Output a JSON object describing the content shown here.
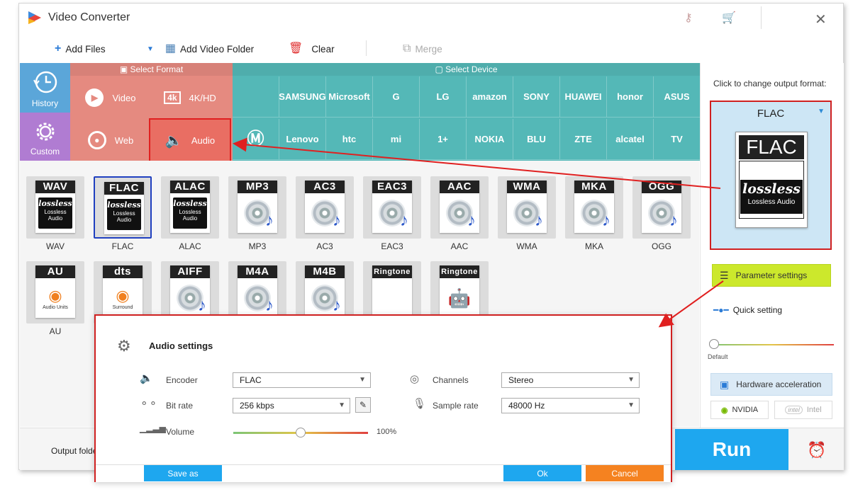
{
  "app": {
    "title": "Video Converter"
  },
  "toolbar": {
    "add_files": "Add Files",
    "add_folder": "Add Video Folder",
    "clear": "Clear",
    "merge": "Merge"
  },
  "tiles": {
    "history": "History",
    "custom": "Custom"
  },
  "format_panel": {
    "title": "Select Format",
    "video": "Video",
    "k4": "4K/HD",
    "web": "Web",
    "audio": "Audio"
  },
  "device_panel": {
    "title": "Select Device",
    "row1": [
      "",
      "SAMSUNG",
      "Microsoft",
      "G",
      "LG",
      "amazon",
      "SONY",
      "HUAWEI",
      "honor",
      "ASUS"
    ],
    "row2": [
      "",
      "Lenovo",
      "htc",
      "mi",
      "1+",
      "NOKIA",
      "BLU",
      "ZTE",
      "alcatel",
      "TV"
    ]
  },
  "formats": {
    "row1": [
      {
        "hdr": "WAV",
        "label": "WAV",
        "kind": "lossless",
        "l1": "lossless",
        "l2": "Lossless",
        "l3": "Audio"
      },
      {
        "hdr": "FLAC",
        "label": "FLAC",
        "kind": "lossless",
        "l1": "lossless",
        "l2": "Lossless",
        "l3": "Audio"
      },
      {
        "hdr": "ALAC",
        "label": "ALAC",
        "kind": "lossless",
        "l1": "lossless",
        "l2": "Lossless",
        "l3": "Audio"
      },
      {
        "hdr": "MP3",
        "label": "MP3",
        "kind": "disc"
      },
      {
        "hdr": "AC3",
        "label": "AC3",
        "kind": "disc"
      },
      {
        "hdr": "EAC3",
        "label": "EAC3",
        "kind": "disc"
      },
      {
        "hdr": "AAC",
        "label": "AAC",
        "kind": "disc"
      },
      {
        "hdr": "WMA",
        "label": "WMA",
        "kind": "disc"
      },
      {
        "hdr": "MKA",
        "label": "MKA",
        "kind": "disc"
      },
      {
        "hdr": "OGG",
        "label": "OGG",
        "kind": "disc"
      }
    ],
    "row2": [
      {
        "hdr": "AU",
        "label": "AU",
        "sub": "Audio Units"
      },
      {
        "hdr": "dts",
        "sub": "Surround"
      },
      {
        "hdr": "AIFF"
      },
      {
        "hdr": "M4A"
      },
      {
        "hdr": "M4B"
      },
      {
        "hdr": "Ringtone"
      },
      {
        "hdr": "Ringtone"
      }
    ]
  },
  "output": {
    "title": "Click to change output format:",
    "format": "FLAC",
    "card_hdr": "FLAC",
    "card_logo": "lossless",
    "card_sub": "Lossless Audio",
    "param": "Parameter settings",
    "quick": "Quick setting",
    "default": "Default",
    "hw": "Hardware acceleration",
    "nvidia": "NVIDIA",
    "intel": "Intel"
  },
  "bottom": {
    "output_folder": "Output folder",
    "run": "Run"
  },
  "dialog": {
    "title": "Audio settings",
    "encoder_label": "Encoder",
    "encoder": "FLAC",
    "bitrate_label": "Bit rate",
    "bitrate": "256 kbps",
    "volume_label": "Volume",
    "volume": "100%",
    "volume_level": 0.5,
    "channels_label": "Channels",
    "channels": "Stereo",
    "samplerate_label": "Sample rate",
    "samplerate": "48000 Hz",
    "save_as": "Save as",
    "ok": "Ok",
    "cancel": "Cancel"
  },
  "colors": {
    "format_bg": "#e58a80",
    "device_bg": "#54b8b7",
    "run_bg": "#1ea7ef",
    "highlight": "#d02020"
  }
}
